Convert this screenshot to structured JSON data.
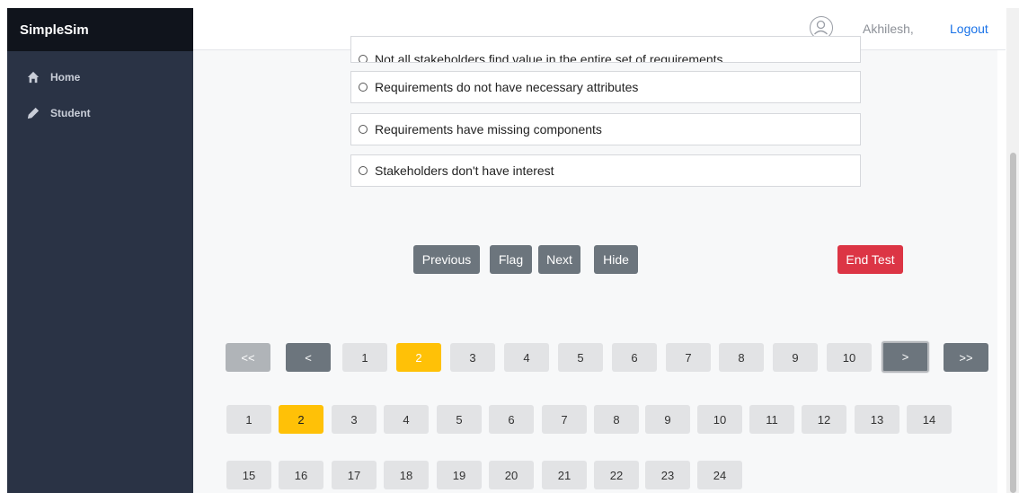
{
  "app": {
    "brand": "SimpleSim"
  },
  "sidebar": {
    "items": [
      {
        "label": "Home",
        "icon": "home-icon"
      },
      {
        "label": "Student",
        "icon": "pencil-icon"
      }
    ]
  },
  "header": {
    "username": "Akhilesh,",
    "logout": "Logout"
  },
  "question": {
    "options": [
      "Not all stakeholders find value in the entire set of requirements",
      "Requirements do not have necessary attributes",
      "Requirements have missing components",
      "Stakeholders don't have interest"
    ]
  },
  "controls": {
    "previous": "Previous",
    "flag": "Flag",
    "next": "Next",
    "hide": "Hide",
    "end_test": "End Test"
  },
  "pager": {
    "first": "<<",
    "prev": "<",
    "next": ">",
    "last": ">>",
    "pages": [
      "1",
      "2",
      "3",
      "4",
      "5",
      "6",
      "7",
      "8",
      "9",
      "10"
    ],
    "current": "2"
  },
  "question_grid": {
    "row1": [
      "1",
      "2",
      "3",
      "4",
      "5",
      "6",
      "7",
      "8",
      "9",
      "10",
      "11",
      "12",
      "13",
      "14"
    ],
    "row2": [
      "15",
      "16",
      "17",
      "18",
      "19",
      "20",
      "21",
      "22",
      "23",
      "24"
    ],
    "current": "2"
  },
  "colors": {
    "sidebar": "#2a3345",
    "brand_bar": "#10141c",
    "active": "#ffc107",
    "danger": "#dc3545",
    "secondary": "#6c757d",
    "link": "#1a73e8"
  }
}
